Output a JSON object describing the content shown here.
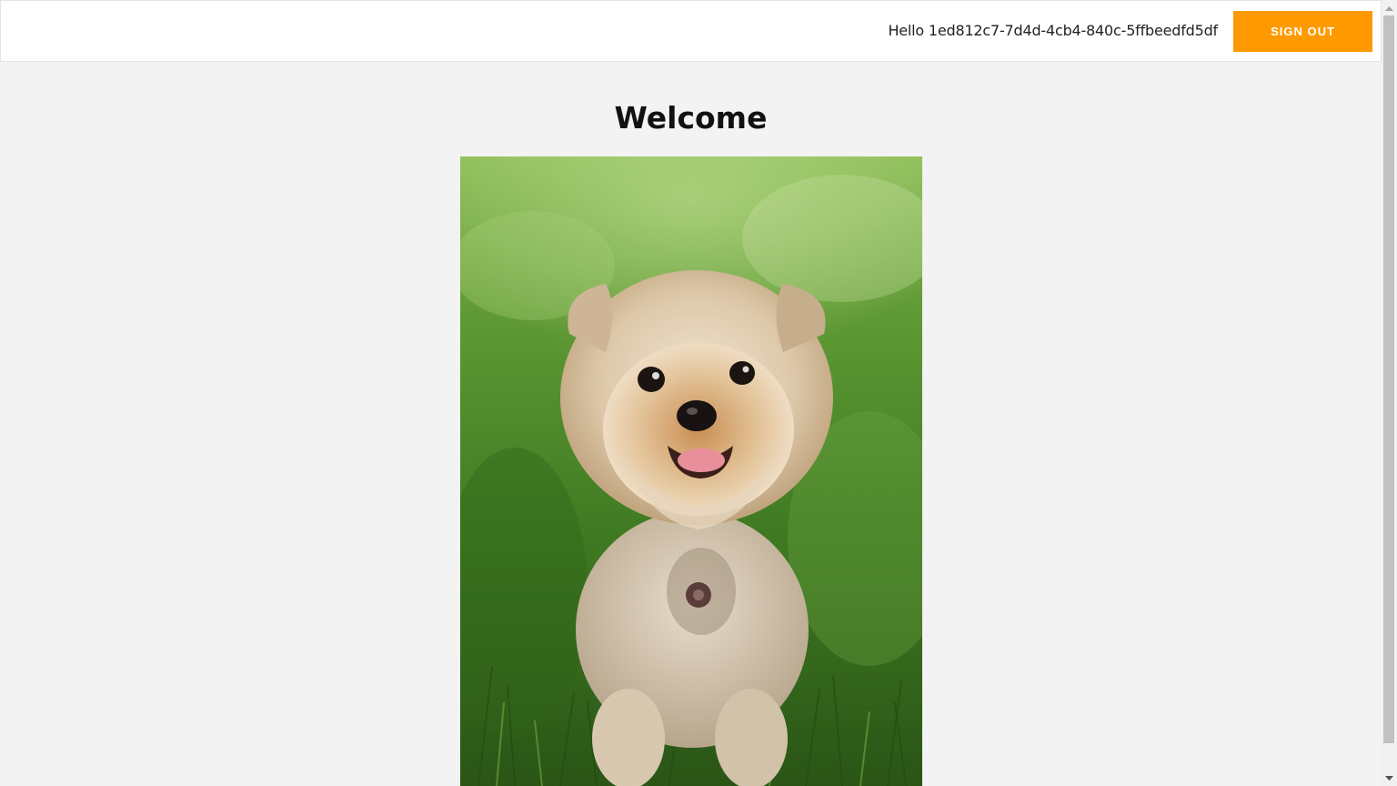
{
  "header": {
    "greeting": "Hello 1ed812c7-7d4d-4cb4-840c-5ffbeedfd5df",
    "sign_out_label": "SIGN OUT",
    "accent_color": "#ff9900"
  },
  "main": {
    "title": "Welcome",
    "photo_subject": "small fluffy dog sitting in green grass"
  },
  "scrollbar": {
    "up_icon": "chevron-up-icon",
    "down_icon": "chevron-down-icon"
  }
}
